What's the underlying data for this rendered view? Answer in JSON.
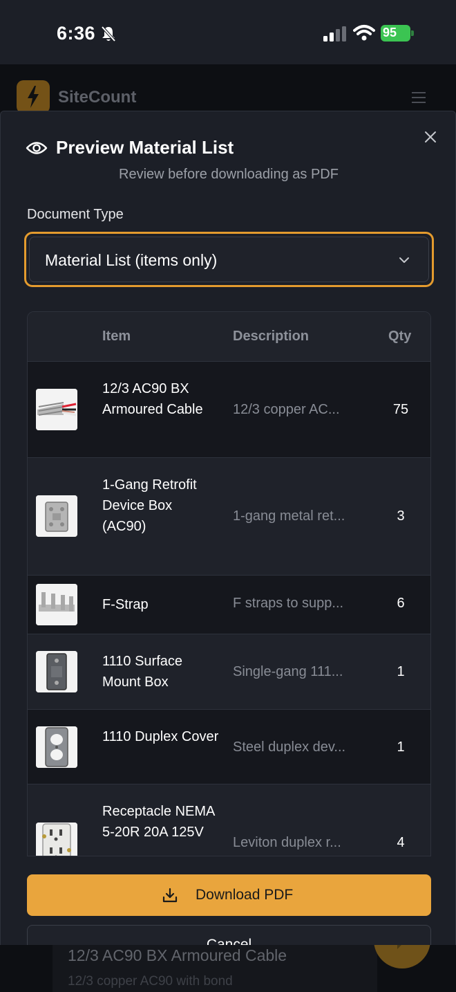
{
  "status_bar": {
    "time": "6:36",
    "battery_percent": "95",
    "icons": [
      "bell-slash-icon",
      "signal-icon",
      "wifi-icon",
      "battery-charging-icon"
    ]
  },
  "app": {
    "name": "SiteCount",
    "logo_icon": "lightning-bolt-icon",
    "menu_icon": "hamburger-menu-icon"
  },
  "modal": {
    "title": "Preview Material List",
    "title_icon": "eye-icon",
    "subtitle": "Review before downloading as PDF",
    "close_icon": "close-icon",
    "document_type": {
      "label": "Document Type",
      "selected": "Material List (items only)"
    },
    "table": {
      "headers": {
        "item": "Item",
        "description": "Description",
        "qty": "Qty"
      },
      "rows": [
        {
          "name": "12/3 AC90 BX Armoured Cable",
          "description": "12/3 copper AC...",
          "qty": "75",
          "thumb": "armoured-cable-thumbnail"
        },
        {
          "name": "1-Gang Retrofit Device Box (AC90)",
          "description": "1-gang metal ret...",
          "qty": "3",
          "thumb": "device-box-thumbnail"
        },
        {
          "name": "F-Strap",
          "description": "F straps to supp...",
          "qty": "6",
          "thumb": "f-strap-thumbnail"
        },
        {
          "name": "1110 Surface Mount Box",
          "description": "Single-gang 111...",
          "qty": "1",
          "thumb": "surface-box-thumbnail"
        },
        {
          "name": "1110 Duplex Cover",
          "description": "Steel duplex dev...",
          "qty": "1",
          "thumb": "duplex-cover-thumbnail"
        },
        {
          "name": "Receptacle NEMA 5-20R 20A 125V",
          "description": "Leviton duplex r...",
          "qty": "4",
          "thumb": "receptacle-thumbnail"
        }
      ]
    },
    "download_label": "Download PDF",
    "download_icon": "download-icon",
    "cancel_label": "Cancel"
  },
  "background": {
    "card_title": "12/3 AC90 BX Armoured Cable",
    "card_subtitle": "12/3 copper AC90 with bond",
    "fab_icon": "chat-icon"
  },
  "colors": {
    "accent": "#e9a53d",
    "modal_bg": "#1c1f27",
    "row_dark": "#15171d",
    "row_light": "#1f222a"
  }
}
